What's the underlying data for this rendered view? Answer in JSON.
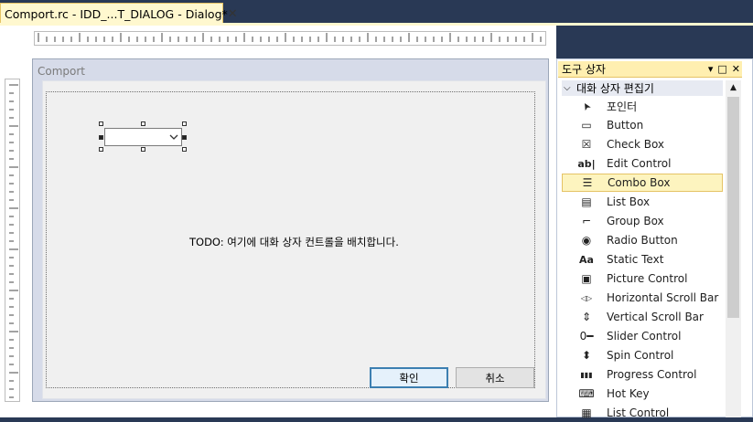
{
  "document_tab": {
    "title": "Comport.rc - IDD_...T_DIALOG - Dialog*",
    "close_glyph": "✕"
  },
  "dialog": {
    "title": "Comport",
    "todo_text": "TODO: 여기에 대화 상자 컨트롤을 배치합니다.",
    "ok_label": "확인",
    "cancel_label": "취소",
    "combo_value": ""
  },
  "toolbox": {
    "title": "도구 상자",
    "group": "대화 상자 편집기",
    "selected": "Combo Box",
    "items": [
      {
        "label": "포인터",
        "icon": "pointer-icon"
      },
      {
        "label": "Button",
        "icon": "button-icon"
      },
      {
        "label": "Check Box",
        "icon": "checkbox-icon"
      },
      {
        "label": "Edit Control",
        "icon": "edit-control-icon"
      },
      {
        "label": "Combo Box",
        "icon": "combo-box-icon"
      },
      {
        "label": "List Box",
        "icon": "list-box-icon"
      },
      {
        "label": "Group Box",
        "icon": "group-box-icon"
      },
      {
        "label": "Radio Button",
        "icon": "radio-button-icon"
      },
      {
        "label": "Static Text",
        "icon": "static-text-icon"
      },
      {
        "label": "Picture Control",
        "icon": "picture-control-icon"
      },
      {
        "label": "Horizontal Scroll Bar",
        "icon": "hscrollbar-icon"
      },
      {
        "label": "Vertical Scroll Bar",
        "icon": "vscrollbar-icon"
      },
      {
        "label": "Slider Control",
        "icon": "slider-icon"
      },
      {
        "label": "Spin Control",
        "icon": "spin-icon"
      },
      {
        "label": "Progress Control",
        "icon": "progress-icon"
      },
      {
        "label": "Hot Key",
        "icon": "hotkey-icon"
      },
      {
        "label": "List Control",
        "icon": "list-control-icon"
      }
    ]
  },
  "colors": {
    "frame": "#293955",
    "tab_active": "#fff8cf",
    "selection": "#fdf4bf",
    "accent_border": "#e5c365"
  }
}
